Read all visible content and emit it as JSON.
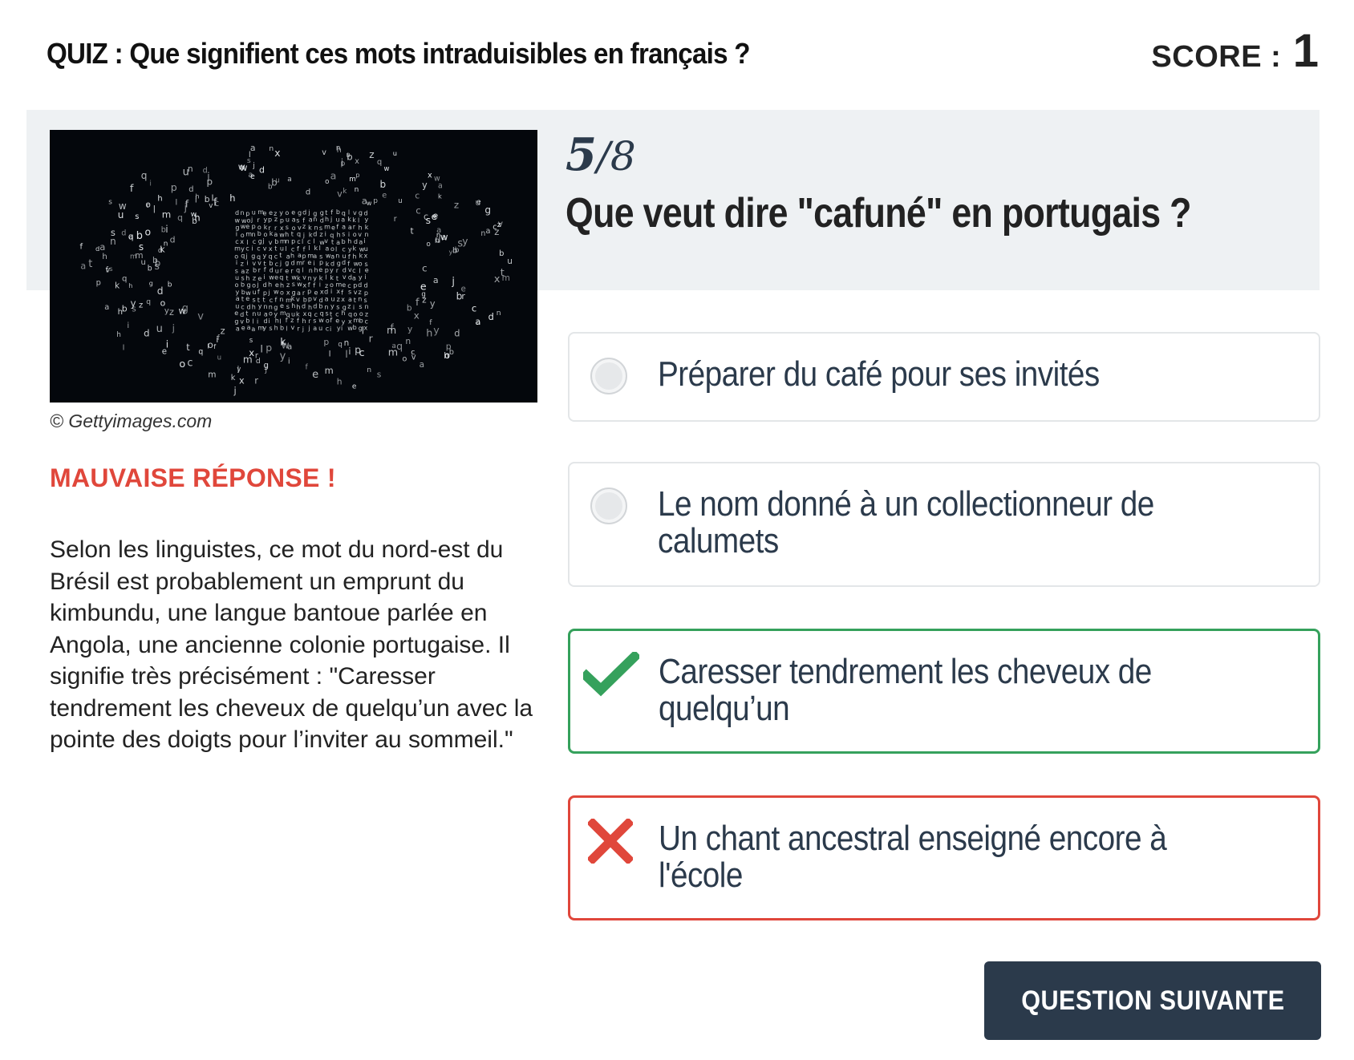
{
  "header": {
    "quiz_title": "QUIZ : Que signifient ces mots intraduisibles en français ?",
    "score_label": "SCORE :",
    "score_value": "1"
  },
  "media": {
    "icon": "scattered-letters-photo",
    "credit": "© Gettyimages.com"
  },
  "feedback": {
    "verdict": "MAUVAISE RÉPONSE !",
    "verdict_color": "#e0473b",
    "explanation": "Selon les linguistes, ce mot du nord-est du Brésil est probablement un emprunt du kimbundu, une langue bantoue parlée en Angola, une ancienne colonie portugaise. Il signifie très précisément : \"Caresser tendrement les cheveux de quelqu’un avec la pointe des doigts pour l’inviter au sommeil.\""
  },
  "question": {
    "current": "5",
    "separator": "/",
    "total": "8",
    "text": "Que veut dire \"cafuné\" en portugais ?"
  },
  "answers": [
    {
      "label": "Préparer du café pour ses invités",
      "state": "neutral",
      "icon": "radio-icon"
    },
    {
      "label": "Le nom donné à un collectionneur de calumets",
      "state": "neutral",
      "icon": "radio-icon"
    },
    {
      "label": "Caresser tendrement les cheveux de quelqu’un",
      "state": "correct",
      "icon": "check-icon"
    },
    {
      "label": "Un chant ancestral enseigné encore à l'école",
      "state": "wrong",
      "icon": "cross-icon"
    }
  ],
  "colors": {
    "correct": "#35a15c",
    "wrong": "#e0473b",
    "button_bg": "#2b3a4b",
    "band_bg": "#eef1f3"
  },
  "next_button": {
    "label": "QUESTION SUIVANTE"
  }
}
